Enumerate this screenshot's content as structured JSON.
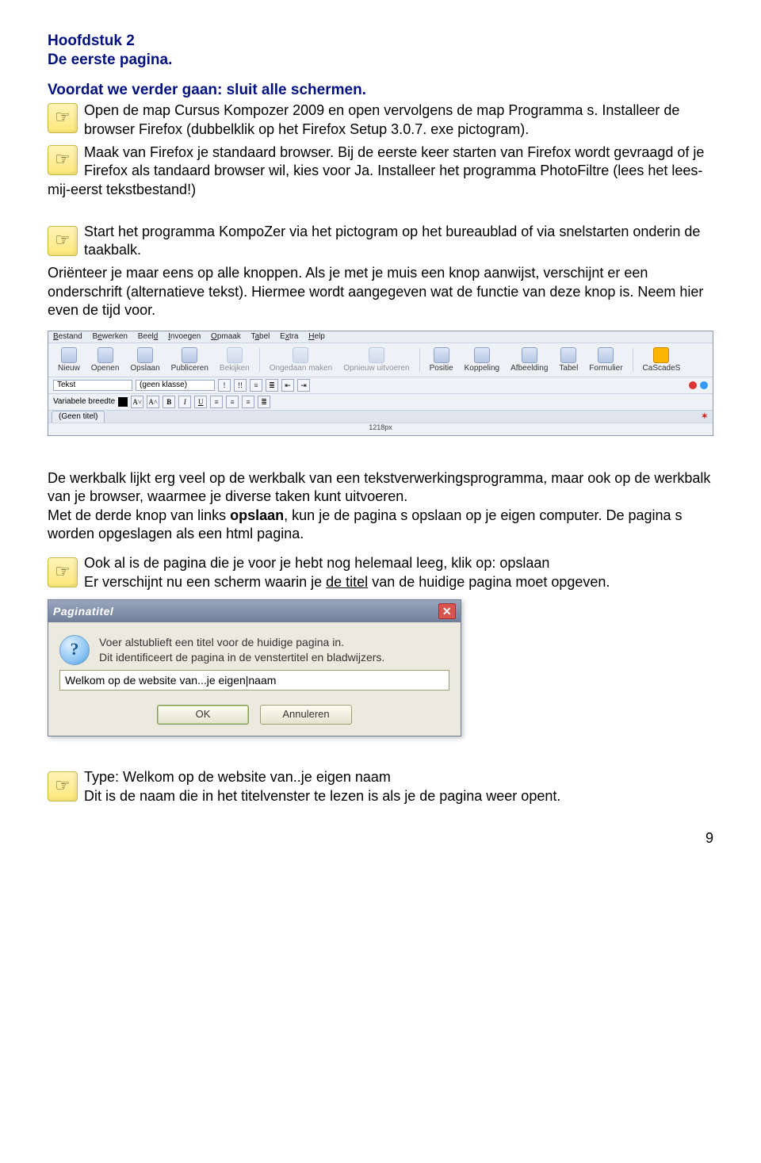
{
  "headings": {
    "chapter": "Hoofdstuk 2",
    "title": "De eerste pagina.",
    "instruction": "Voordat we verder gaan: sluit alle schermen."
  },
  "actions": {
    "a1": "Open de map Cursus Kompozer 2009 en open vervolgens de map Programma s. Installeer de browser Firefox (dubbelklik op het Firefox Setup 3.0.7. exe pictogram).",
    "a2a": "Maak van Firefox je standaard browser. Bij de eerste keer starten van Firefox wordt gevraagd of je Firefox als tandaard browser wil, kies voor Ja.",
    "a2b": "Installeer het programma PhotoFiltre (lees het lees-mij-eerst tekstbestand!)",
    "a3": "Start het programma KompoZer via het pictogram op het bureaublad of via snelstarten onderin de taakbalk.",
    "a4": "Ook al is de pagina die je voor je hebt nog helemaal leeg, klik op: opslaan",
    "a4b_before": "Er verschijnt nu een scherm waarin je ",
    "a4b_underlined": "de titel",
    "a4b_after": " van de huidige pagina moet opgeven.",
    "a5_line1": "Type: Welkom op de website van..je eigen naam",
    "a5_line2": "Dit is de naam die in het titelvenster te lezen is als je de pagina weer opent."
  },
  "paragraphs": {
    "p1": "Oriënteer je maar eens op alle knoppen. Als je met je muis een knop aanwijst, verschijnt er een onderschrift (alternatieve tekst). Hiermee wordt aangegeven wat de functie van deze knop is. Neem hier even de tijd voor.",
    "p2_before": "De werkbalk lijkt erg veel op de werkbalk van een tekstverwerkingsprogramma, maar ook op de werkbalk van je browser, waarmee je diverse taken kunt uitvoeren.\nMet de derde knop van links ",
    "p2_bold": "opslaan",
    "p2_after": ", kun je de pagina s opslaan op je eigen computer. De pagina s worden opgeslagen als een html pagina."
  },
  "toolbar": {
    "menus": [
      "Bestand",
      "Bewerken",
      "Beeld",
      "Invoegen",
      "Opmaak",
      "Tabel",
      "Extra",
      "Help"
    ],
    "buttons": [
      "Nieuw",
      "Openen",
      "Opslaan",
      "Publiceren",
      "Bekijken",
      "Ongedaan maken",
      "Opnieuw uitvoeren",
      "Positie",
      "Koppeling",
      "Afbeelding",
      "Tabel",
      "Formulier",
      "CaScadeS"
    ],
    "format_row1": {
      "paragraph": "Tekst",
      "class": "(geen klasse)"
    },
    "format_row2": {
      "font": "Variabele breedte"
    },
    "tab_title": "(Geen titel)",
    "ruler_value": "1218px"
  },
  "dialog": {
    "title": "Paginatitel",
    "msg_line1": "Voer alstublieft een titel voor de huidige pagina in.",
    "msg_line2": "Dit identificeert de pagina in de venstertitel en bladwijzers.",
    "input_value": "Welkom op de website van...je eigen|naam",
    "ok": "OK",
    "cancel": "Annuleren"
  },
  "page_number": "9"
}
